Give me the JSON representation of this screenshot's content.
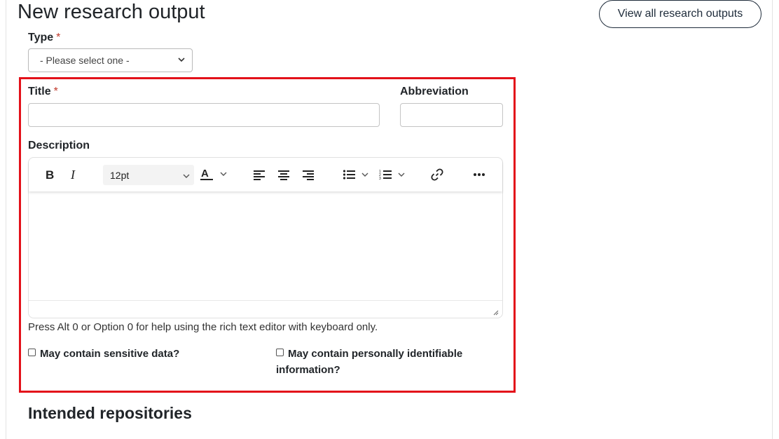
{
  "header": {
    "title": "New research output",
    "view_all_label": "View all research outputs"
  },
  "form": {
    "type": {
      "label": "Type",
      "required_mark": "*",
      "selected": "- Please select one -"
    },
    "title": {
      "label": "Title",
      "required_mark": "*",
      "value": ""
    },
    "abbreviation": {
      "label": "Abbreviation",
      "value": ""
    },
    "description": {
      "label": "Description",
      "font_size": "12pt",
      "help_text": "Press Alt 0 or Option 0 for help using the rich text editor with keyboard only."
    },
    "sensitive_data": {
      "label": "May contain sensitive data?",
      "checked": false
    },
    "pii": {
      "label_line1": "May contain personally identifiable",
      "label_line2": "information?",
      "checked": false
    }
  },
  "sections": {
    "intended_repositories": "Intended repositories"
  },
  "toolbar_icons": [
    "bold-icon",
    "italic-icon",
    "text-color-icon",
    "align-left-icon",
    "align-center-icon",
    "align-right-icon",
    "bullet-list-icon",
    "numbered-list-icon",
    "link-icon",
    "more-icon"
  ],
  "colors": {
    "highlight": "#e3111a",
    "required": "#c0392b",
    "button_border": "#1e2b3a"
  }
}
